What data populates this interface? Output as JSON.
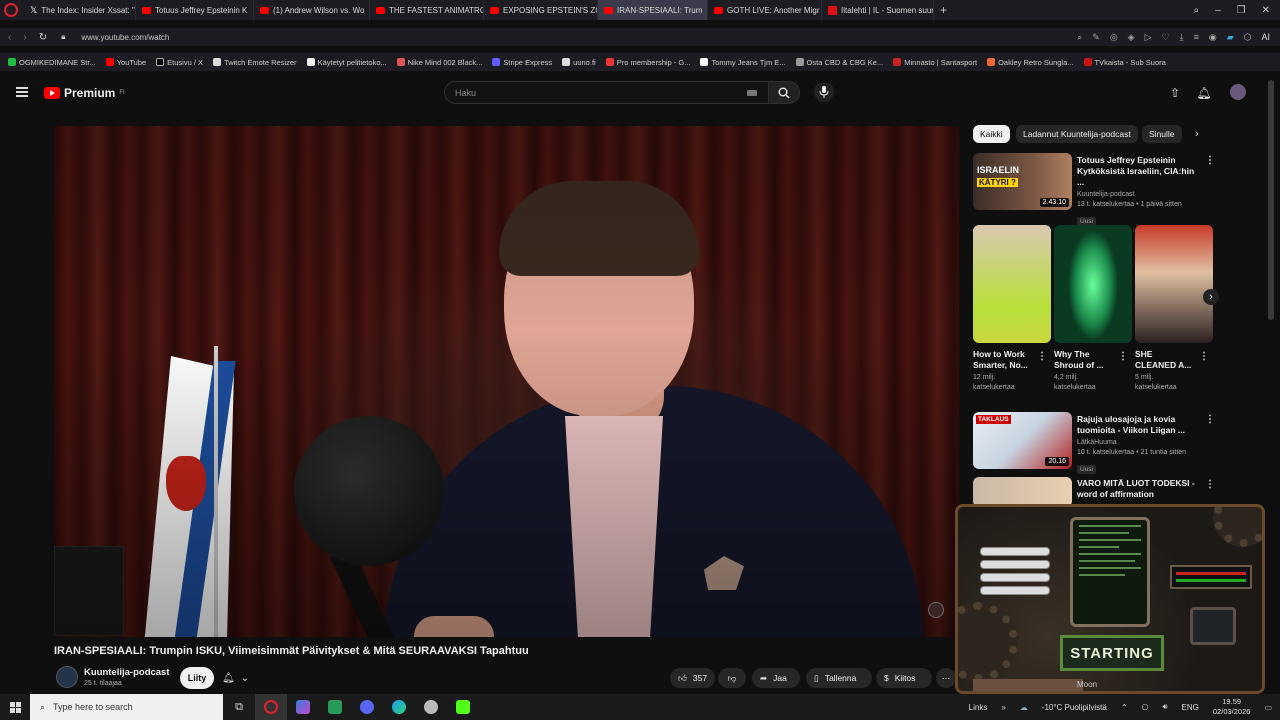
{
  "browser": {
    "tabs": [
      {
        "icon": "x-icon",
        "label": "The Index: Insider Xssat: \"S"
      },
      {
        "icon": "youtube-icon",
        "label": "Totuus Jeffrey Epsteinin K"
      },
      {
        "icon": "youtube-icon",
        "label": "(1) Andrew Wilson vs. Wo"
      },
      {
        "icon": "youtube-icon",
        "label": "THE FASTEST ANIMATRON"
      },
      {
        "icon": "youtube-icon",
        "label": "EXPOSING EPSTEIN'S ZOR"
      },
      {
        "icon": "youtube-icon",
        "label": "IRAN-SPESIAALI: Trum"
      },
      {
        "icon": "youtube-icon",
        "label": "GOTH LIVE: Another Migr"
      },
      {
        "icon": "iltalehti-icon",
        "label": "Iltalehti | IL - Suomen suur"
      }
    ],
    "url": "www.youtube.com/watch",
    "toolbar_ai": "AI",
    "bookmarks": [
      "OGMIKEDIMANE Str...",
      "YouTube",
      "Etusivu / X",
      "Twitch Emote Resizer",
      "Käytetyt pelitietoko...",
      "Nike Mind 002 Black...",
      "Stripe Express",
      "uuno.fi",
      "Pro membership - G...",
      "Tommy Jeans Tjm E...",
      "Osta CBD & CBG Ke...",
      "Minnasto | Santasport",
      "Oakley Retro Sungla...",
      "TVkaista - Sub Suora"
    ]
  },
  "youtube": {
    "logo": "Premium",
    "logo_sup": "FI",
    "search_placeholder": "Haku"
  },
  "video": {
    "title": "IRAN-SPESIAALI: Trumpin ISKU, Viimeisimmät Päivitykset & Mitä SEURAAVAKSI Tapahtuu",
    "channel": "Kuuntelija-podcast",
    "subscribers": "25 t. tilaajaa",
    "join_label": "Liity",
    "likes": "357",
    "share_label": "Jaa",
    "save_label": "Tallenna",
    "thanks_label": "Kiitos"
  },
  "sidebar": {
    "chips": [
      "Kaikki",
      "Ladannut Kuuntelija-podcast",
      "Sinulle"
    ],
    "top_video": {
      "title_l1": "Totuus Jeffrey Epsteinin",
      "title_l2": "Kytköksistä Israeliin, CIA:hin ...",
      "channel": "Kuuntelija-podcast",
      "meta": "13 t. katselukertaa • 1 päivä sitten",
      "badge": "Uusi",
      "duration": "2.43.10",
      "thumb_text_1": "ISRAELIN",
      "thumb_text_2": "KÄTYRI ?"
    },
    "shorts": [
      {
        "t1": "How to Work",
        "t2": "Smarter, No...",
        "m1": "12 milj.",
        "m2": "katselukertaa"
      },
      {
        "t1": "Why The",
        "t2": "Shroud of ...",
        "m1": "4,2 milj.",
        "m2": "katselukertaa"
      },
      {
        "t1": "SHE",
        "t2": "CLEANED A...",
        "m1": "5 milj.",
        "m2": "katselukertaa"
      }
    ],
    "hockey_video": {
      "title_l1": "Rajuja ulosajoja ja kovia",
      "title_l2": "tuomioita - Viikon Liigan ...",
      "channel": "LätkäHuuma",
      "meta": "10 t. katselukertaa • 21 tuntia sitten",
      "badge": "Uusi",
      "duration": "20.16",
      "thumb_text": "TAKLAUS"
    },
    "last_video": {
      "title_l1": "VARO MITÄ LUOT TODEKSI -",
      "title_l2": "word of affirmation"
    }
  },
  "overlay": {
    "starting_label": "STARTING",
    "moon_label": "Moon"
  },
  "taskbar": {
    "search_placeholder": "Type here to search",
    "links_label": "Links",
    "weather": "-10°C  Puolipilvistä",
    "lang": "ENG",
    "time": "19.59",
    "date": "02/03/2026"
  },
  "colors": {
    "yt_red": "#ff0000",
    "bg": "#0f0f0f",
    "browser_accent": "#e0202a"
  }
}
